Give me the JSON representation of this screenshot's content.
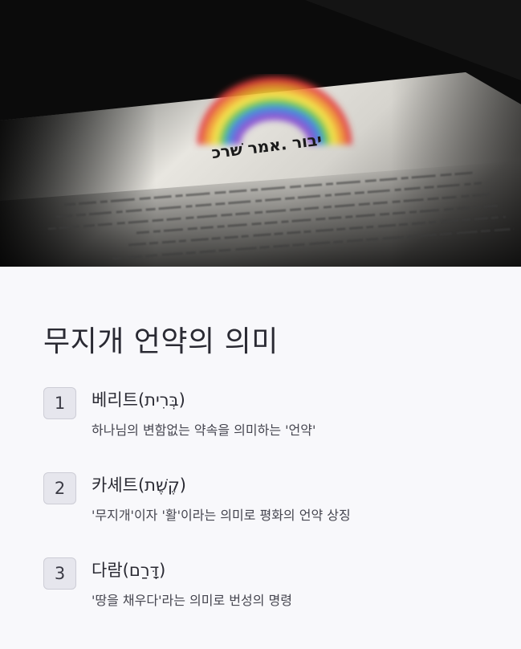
{
  "hero": {
    "image_description_icon": "book-with-rainbow-image",
    "hebrew_text": "יבור .אמר שׁרכ",
    "colors": {
      "rainbow": [
        "#e53a3a",
        "#f39a2d",
        "#f4e23a",
        "#4fc24f",
        "#3a76e0",
        "#7a3ad0"
      ]
    }
  },
  "main": {
    "title": "무지개 언약의 의미",
    "items": [
      {
        "number": "1",
        "heading": "베리트(בְּרִית)",
        "description": "하나님의 변함없는 약속을 의미하는 '언약'"
      },
      {
        "number": "2",
        "heading": "카셰트(קֶשֶׁת)",
        "description": "'무지개'이자 '활'이라는 의미로 평화의 언약 상징"
      },
      {
        "number": "3",
        "heading": "다람(דָּרַם)",
        "description": "'땅을 채우다'라는 의미로 번성의 명령"
      }
    ]
  }
}
